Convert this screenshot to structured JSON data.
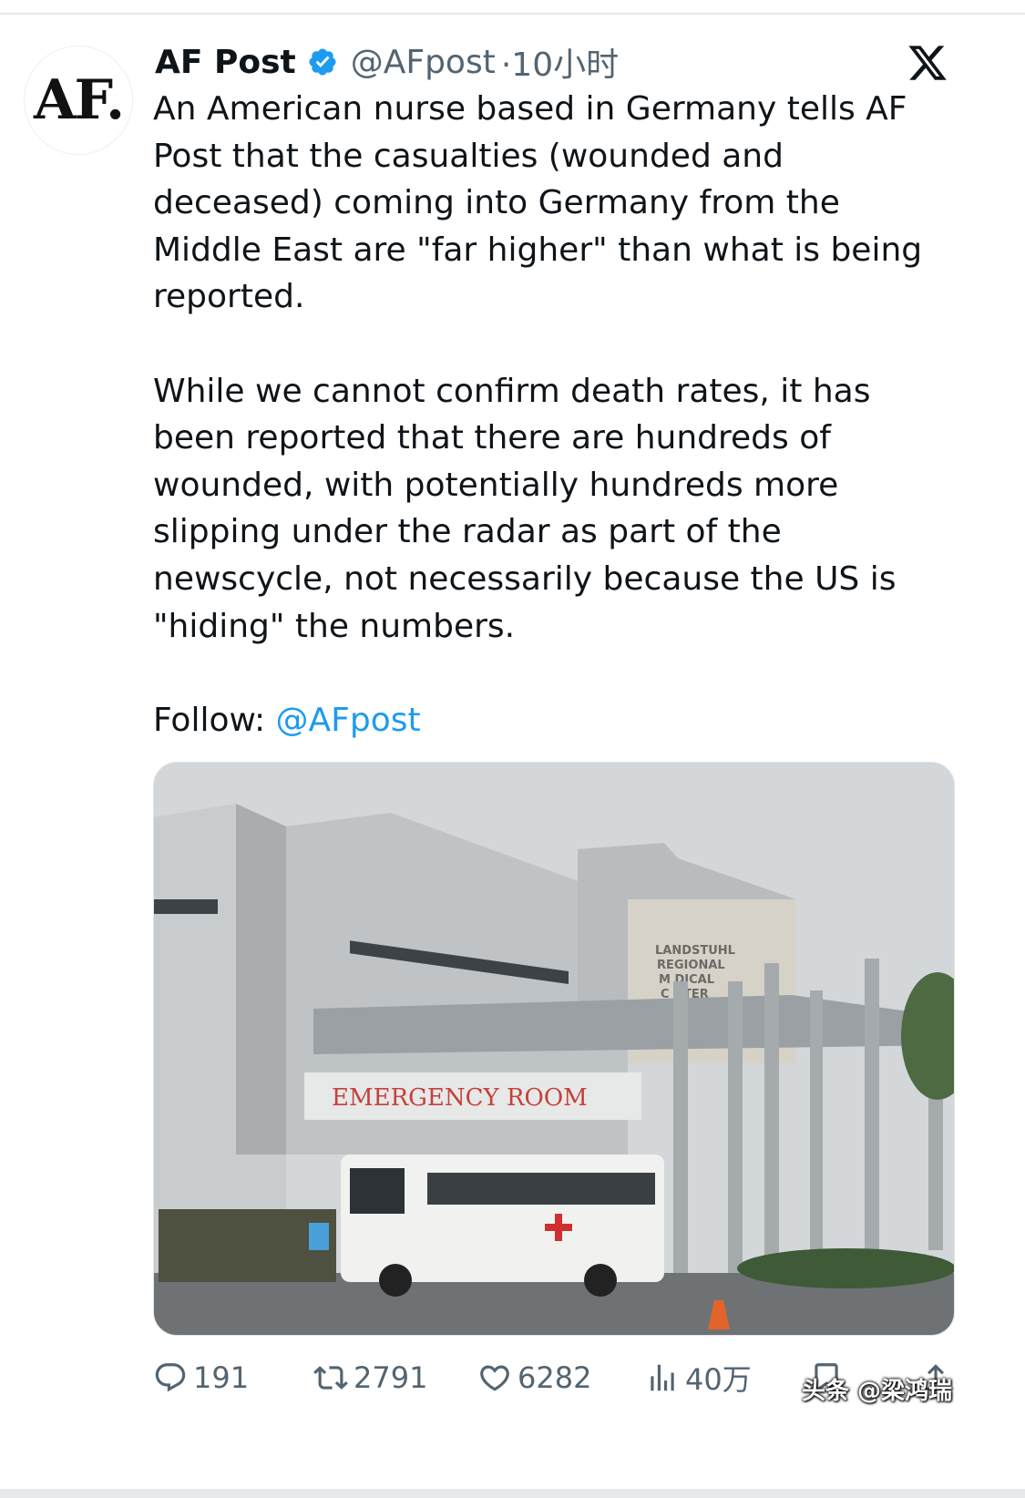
{
  "tweet": {
    "avatar_text": "AF.",
    "author_name": "AF Post",
    "handle": "@AFpost",
    "time": "·10小时",
    "paragraph1": "An American nurse based in Germany tells AF Post that the casualties (wounded and deceased) coming into Germany from the Middle East are \"far higher\" than what is being reported.",
    "paragraph2": "While we cannot confirm death rates, it has been reported that there are hundreds of wounded, with potentially hundreds more slipping under the radar as part of the newscycle, not necessarily because the US is \"hiding\" the numbers.",
    "follow_label": "Follow: ",
    "follow_link": "@AFpost",
    "media": {
      "building_sign": [
        "LANDSTUHL",
        "REGIONAL",
        "M DICAL",
        "C NTER"
      ],
      "er_sign": "EMERGENCY ROOM"
    },
    "actions": {
      "replies": "191",
      "reposts": "2791",
      "likes": "6282",
      "views": "40万"
    }
  },
  "watermark": "头条 @梁鸿瑞",
  "colors": {
    "link": "#1d9bf0",
    "verified": "#1d9bf0",
    "muted": "#536471"
  }
}
